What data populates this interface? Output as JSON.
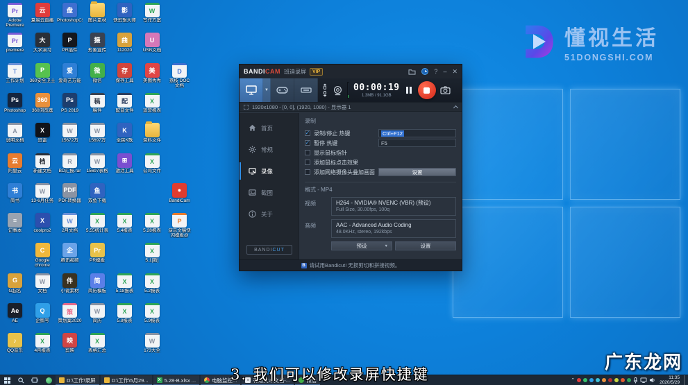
{
  "colors": {
    "accent_blue": "#2f8fe8",
    "selection_blue": "#2f6fd0",
    "stop_red": "#e03a28",
    "taskbar_bg": "#1c2836",
    "desktop_blue": "#0d80da",
    "vip_gold": "#f0b83c"
  },
  "watermark": {
    "title": "懂视生活",
    "domain": "51DONGSHI.COM"
  },
  "corner_logo": "广东龙网",
  "subtitle": "3. 我们可以修改录屏快捷键",
  "bandicam": {
    "title": {
      "brand_1": "BANDI",
      "brand_2": "CAM",
      "subtitle": "班迪录屏",
      "vip": "VIP",
      "icons": [
        "folder-icon",
        "history-clock-icon",
        "help-icon",
        "minimize-icon",
        "close-icon"
      ]
    },
    "toolbar": {
      "modes": [
        "screen-recording-mode",
        "game-recording-mode",
        "device-recording-mode"
      ],
      "timer": "00:00:19",
      "size_info": "1.3MB / 91.1GB"
    },
    "region_bar": {
      "text": "1920x1080 - [0, 0], (1920, 1080) - 显示器 1"
    },
    "sidebar": {
      "items": [
        {
          "icon": "home",
          "label": "首页",
          "active": false
        },
        {
          "icon": "gear",
          "label": "常规",
          "active": false
        },
        {
          "icon": "video",
          "label": "录像",
          "active": true
        },
        {
          "icon": "image",
          "label": "截图",
          "active": false
        },
        {
          "icon": "info",
          "label": "关于",
          "active": false
        }
      ],
      "bandicut_1": "BANDI",
      "bandicut_2": "CUT"
    },
    "settings": {
      "section_record": "录制",
      "rows": [
        {
          "checked": true,
          "label": "录制/停止 热键",
          "value": "Ctrl+F12",
          "value_selected": true
        },
        {
          "checked": true,
          "label": "暂停 热键",
          "value": "F5",
          "value_selected": false
        },
        {
          "checked": false,
          "label": "显示鼠标指针"
        },
        {
          "checked": false,
          "label": "添加鼠标点击效果"
        },
        {
          "checked": false,
          "label": "添加网络摄像头叠加画面",
          "button": "设置"
        }
      ],
      "section_format": "格式 - MP4",
      "video_label": "视频",
      "video_line1": "H264 - NVIDIA® NVENC (VBR) (预设)",
      "video_line2": "Full Size, 30.00fps, 100q",
      "audio_label": "音频",
      "audio_line1": "AAC - Advanced Audio Coding",
      "audio_line2": "48.0KHz, stereo, 192kbps",
      "preset_button": "预设",
      "settings_button": "设置"
    },
    "footer": "请试用Bandicut! 无损剪切和拼接视频。"
  },
  "desktop": {
    "icons": [
      {
        "c": 0,
        "r": 0,
        "t": "doc",
        "bg": "#7a5cd6",
        "g": "Pr",
        "l": "Adobe Premiere"
      },
      {
        "c": 1,
        "r": 0,
        "t": "app",
        "bg": "#e03c3c",
        "g": "云",
        "l": "夏易云直播"
      },
      {
        "c": 2,
        "r": 0,
        "t": "app",
        "bg": "#3f6fd0",
        "g": "盘",
        "l": "PhotoshopCS6"
      },
      {
        "c": 3,
        "r": 0,
        "t": "folder",
        "bg": "",
        "g": "",
        "l": "图片素材"
      },
      {
        "c": 4,
        "r": 0,
        "t": "app",
        "bg": "#2f63c0",
        "g": "影",
        "l": "快剪辑大师"
      },
      {
        "c": 5,
        "r": 0,
        "t": "doc",
        "bg": "#2fa457",
        "g": "W",
        "l": "写作方案"
      },
      {
        "c": 0,
        "r": 1,
        "t": "doc",
        "bg": "#7a5cd6",
        "g": "Pr",
        "l": "premiere"
      },
      {
        "c": 1,
        "r": 1,
        "t": "app",
        "bg": "#2a2f38",
        "g": "大",
        "l": "大学演习"
      },
      {
        "c": 2,
        "r": 1,
        "t": "app",
        "bg": "#14171d",
        "g": "P",
        "l": "PR插件"
      },
      {
        "c": 3,
        "r": 1,
        "t": "app",
        "bg": "#3a4252",
        "g": "摄",
        "l": "形象宣传"
      },
      {
        "c": 4,
        "r": 1,
        "t": "app",
        "bg": "#d8a23c",
        "g": "曲",
        "l": "112020"
      },
      {
        "c": 5,
        "r": 1,
        "t": "app",
        "bg": "#d678b8",
        "g": "U",
        "l": "USB文档"
      },
      {
        "c": 0,
        "r": 2,
        "t": "doc",
        "bg": "#6a90d8",
        "g": "T",
        "l": "工作计划"
      },
      {
        "c": 1,
        "r": 2,
        "t": "app",
        "bg": "#57c24f",
        "g": "P",
        "l": "360安全卫士"
      },
      {
        "c": 2,
        "r": 2,
        "t": "app",
        "bg": "#2f7fd6",
        "g": "爱",
        "l": "爱奇艺万能"
      },
      {
        "c": 3,
        "r": 2,
        "t": "app",
        "bg": "#43b049",
        "g": "微",
        "l": "微信"
      },
      {
        "c": 4,
        "r": 2,
        "t": "app",
        "bg": "#d0453c",
        "g": "存",
        "l": "保存工具"
      },
      {
        "c": 5,
        "r": 2,
        "t": "app",
        "bg": "#e04545",
        "g": "美",
        "l": "美图秀秀"
      },
      {
        "c": 6,
        "r": 2,
        "t": "doc",
        "bg": "#3f6fd0",
        "g": "D",
        "l": "荔枝 DOC 文档"
      },
      {
        "c": 0,
        "r": 3,
        "t": "app",
        "bg": "#15253f",
        "g": "Ps",
        "l": "Photoshop"
      },
      {
        "c": 1,
        "r": 3,
        "t": "app",
        "bg": "#e8903c",
        "g": "360",
        "l": "360浏览器"
      },
      {
        "c": 2,
        "r": 3,
        "t": "app",
        "bg": "#1d3e6e",
        "g": "Ps",
        "l": "PS 2019"
      },
      {
        "c": 3,
        "r": 3,
        "t": "doc",
        "bg": "#3a4252",
        "g": "稿",
        "l": "稿件"
      },
      {
        "c": 4,
        "r": 3,
        "t": "doc",
        "bg": "#2c3e60",
        "g": "配",
        "l": "配音文件"
      },
      {
        "c": 5,
        "r": 3,
        "t": "doc",
        "bg": "#2fa457",
        "g": "X",
        "l": "运营报表"
      },
      {
        "c": 0,
        "r": 4,
        "t": "doc",
        "bg": "#8a93a3",
        "g": "A",
        "l": "说明文档"
      },
      {
        "c": 1,
        "r": 4,
        "t": "app",
        "bg": "#10131a",
        "g": "X",
        "l": "迅雷"
      },
      {
        "c": 2,
        "r": 4,
        "t": "doc",
        "bg": "#8a93a3",
        "g": "W",
        "l": "15672万"
      },
      {
        "c": 3,
        "r": 4,
        "t": "doc",
        "bg": "#8a93a3",
        "g": "W",
        "l": "15697万"
      },
      {
        "c": 4,
        "r": 4,
        "t": "app",
        "bg": "#2f63c0",
        "g": "K",
        "l": "全民K歌"
      },
      {
        "c": 5,
        "r": 4,
        "t": "folder",
        "bg": "",
        "g": "",
        "l": "资料文件"
      },
      {
        "c": 0,
        "r": 5,
        "t": "app",
        "bg": "#e87c2f",
        "g": "云",
        "l": "阿里云"
      },
      {
        "c": 1,
        "r": 5,
        "t": "doc",
        "bg": "#2a2f38",
        "g": "档",
        "l": "新建文档"
      },
      {
        "c": 2,
        "r": 5,
        "t": "doc",
        "bg": "#8a93a3",
        "g": "R",
        "l": "BD汇报.rar"
      },
      {
        "c": 3,
        "r": 5,
        "t": "doc",
        "bg": "#8a93a3",
        "g": "W",
        "l": "15697表格"
      },
      {
        "c": 4,
        "r": 5,
        "t": "app",
        "bg": "#7a4fd0",
        "g": "⊞",
        "l": "激活工具"
      },
      {
        "c": 5,
        "r": 5,
        "t": "doc",
        "bg": "#2fa457",
        "g": "X",
        "l": "公司文件"
      },
      {
        "c": 0,
        "r": 6,
        "t": "app",
        "bg": "#2f7fd6",
        "g": "书",
        "l": "简书"
      },
      {
        "c": 1,
        "r": 6,
        "t": "doc",
        "bg": "#8a93a3",
        "g": "W",
        "l": "13-6月任务"
      },
      {
        "c": 2,
        "r": 6,
        "t": "app",
        "bg": "#8a93a3",
        "g": "PDF",
        "l": "PDF转换器"
      },
      {
        "c": 3,
        "r": 6,
        "t": "app",
        "bg": "#2f63c0",
        "g": "鱼",
        "l": "双鱼下载"
      },
      {
        "c": 6,
        "r": 6,
        "t": "app",
        "bg": "#e03c2f",
        "g": "●",
        "l": "BandiCam"
      },
      {
        "c": 0,
        "r": 7,
        "t": "app",
        "bg": "#9aa3b0",
        "g": "≡",
        "l": "记事本"
      },
      {
        "c": 1,
        "r": 7,
        "t": "app",
        "bg": "#2c4fae",
        "g": "X",
        "l": "coolpro2"
      },
      {
        "c": 2,
        "r": 7,
        "t": "doc",
        "bg": "#6a90d8",
        "g": "W",
        "l": "2月文档"
      },
      {
        "c": 3,
        "r": 7,
        "t": "doc",
        "bg": "#2fa457",
        "g": "X",
        "l": "5.55统计表"
      },
      {
        "c": 4,
        "r": 7,
        "t": "doc",
        "bg": "#2fa457",
        "g": "X",
        "l": "5.4报表"
      },
      {
        "c": 5,
        "r": 7,
        "t": "doc",
        "bg": "#2fa457",
        "g": "X",
        "l": "5.28报表"
      },
      {
        "c": 6,
        "r": 7,
        "t": "doc",
        "bg": "#e87c2f",
        "g": "P",
        "l": "演示文稿快闪模板@"
      },
      {
        "c": 1,
        "r": 8,
        "t": "app",
        "bg": "#f0b83c",
        "g": "C",
        "l": "Google chrome"
      },
      {
        "c": 2,
        "r": 8,
        "t": "app",
        "bg": "#6aa3e8",
        "g": "企",
        "l": "腾讯视频"
      },
      {
        "c": 3,
        "r": 8,
        "t": "app",
        "bg": "#e8c24a",
        "g": "Pr",
        "l": "PR模板"
      },
      {
        "c": 5,
        "r": 8,
        "t": "doc",
        "bg": "#2fa457",
        "g": "X",
        "l": "5.1[新]"
      },
      {
        "c": 0,
        "r": 9,
        "t": "app",
        "bg": "#d8a23c",
        "g": "G",
        "l": "G起名"
      },
      {
        "c": 1,
        "r": 9,
        "t": "doc",
        "bg": "#8a93a3",
        "g": "W",
        "l": "文档"
      },
      {
        "c": 2,
        "r": 9,
        "t": "app",
        "bg": "#3a3220",
        "g": "件",
        "l": "小说素材"
      },
      {
        "c": 3,
        "r": 9,
        "t": "app",
        "bg": "#5a7fe8",
        "g": "简",
        "l": "简历模板"
      },
      {
        "c": 4,
        "r": 9,
        "t": "doc",
        "bg": "#2fa457",
        "g": "X",
        "l": "5.18报表"
      },
      {
        "c": 5,
        "r": 9,
        "t": "doc",
        "bg": "#2fa457",
        "g": "X",
        "l": "5.2报表"
      },
      {
        "c": 0,
        "r": 10,
        "t": "app",
        "bg": "#1a1f2a",
        "g": "Ae",
        "l": "AE"
      },
      {
        "c": 1,
        "r": 10,
        "t": "app",
        "bg": "#2f9fe8",
        "g": "Q",
        "l": "企鹅号"
      },
      {
        "c": 2,
        "r": 10,
        "t": "doc",
        "bg": "#e86a8a",
        "g": "策",
        "l": "策划案2020"
      },
      {
        "c": 3,
        "r": 10,
        "t": "doc",
        "bg": "#8a93a3",
        "g": "W",
        "l": "简历"
      },
      {
        "c": 4,
        "r": 10,
        "t": "doc",
        "bg": "#2fa457",
        "g": "X",
        "l": "5.8报表"
      },
      {
        "c": 5,
        "r": 10,
        "t": "doc",
        "bg": "#2fa457",
        "g": "X",
        "l": "5.9报表"
      },
      {
        "c": 0,
        "r": 11,
        "t": "app",
        "bg": "#e8c24a",
        "g": "♪",
        "l": "QQ音乐"
      },
      {
        "c": 1,
        "r": 11,
        "t": "doc",
        "bg": "#2fa457",
        "g": "X",
        "l": "4月报表"
      },
      {
        "c": 2,
        "r": 11,
        "t": "app",
        "bg": "#d04545",
        "g": "映",
        "l": "剪映"
      },
      {
        "c": 3,
        "r": 11,
        "t": "doc",
        "bg": "#2fa457",
        "g": "X",
        "l": "表格汇总"
      },
      {
        "c": 5,
        "r": 11,
        "t": "doc",
        "bg": "#8a93a3",
        "g": "W",
        "l": "173大全"
      }
    ]
  },
  "taskbar": {
    "buttons": [
      {
        "icon": "folder",
        "label": "D:\\工作\\录屏"
      },
      {
        "icon": "folder",
        "label": "D:\\工作\\5月29..."
      },
      {
        "icon": "excel",
        "label": "5.28-B.xlsx ..."
      },
      {
        "icon": "chrome",
        "label": "电脑监控..."
      },
      {
        "icon": "doc",
        "label": "有道文本文档-..."
      },
      {
        "icon": "wechat",
        "label": "微信"
      }
    ],
    "tray_dots": [
      "#e03c3c",
      "#35c06a",
      "#2f9fe8",
      "#3cc0d8",
      "#e8903c",
      "#b03030",
      "#c9d641",
      "#e05a2f",
      "#2fa457"
    ],
    "time": "11:35",
    "date": "2020/5/29"
  }
}
